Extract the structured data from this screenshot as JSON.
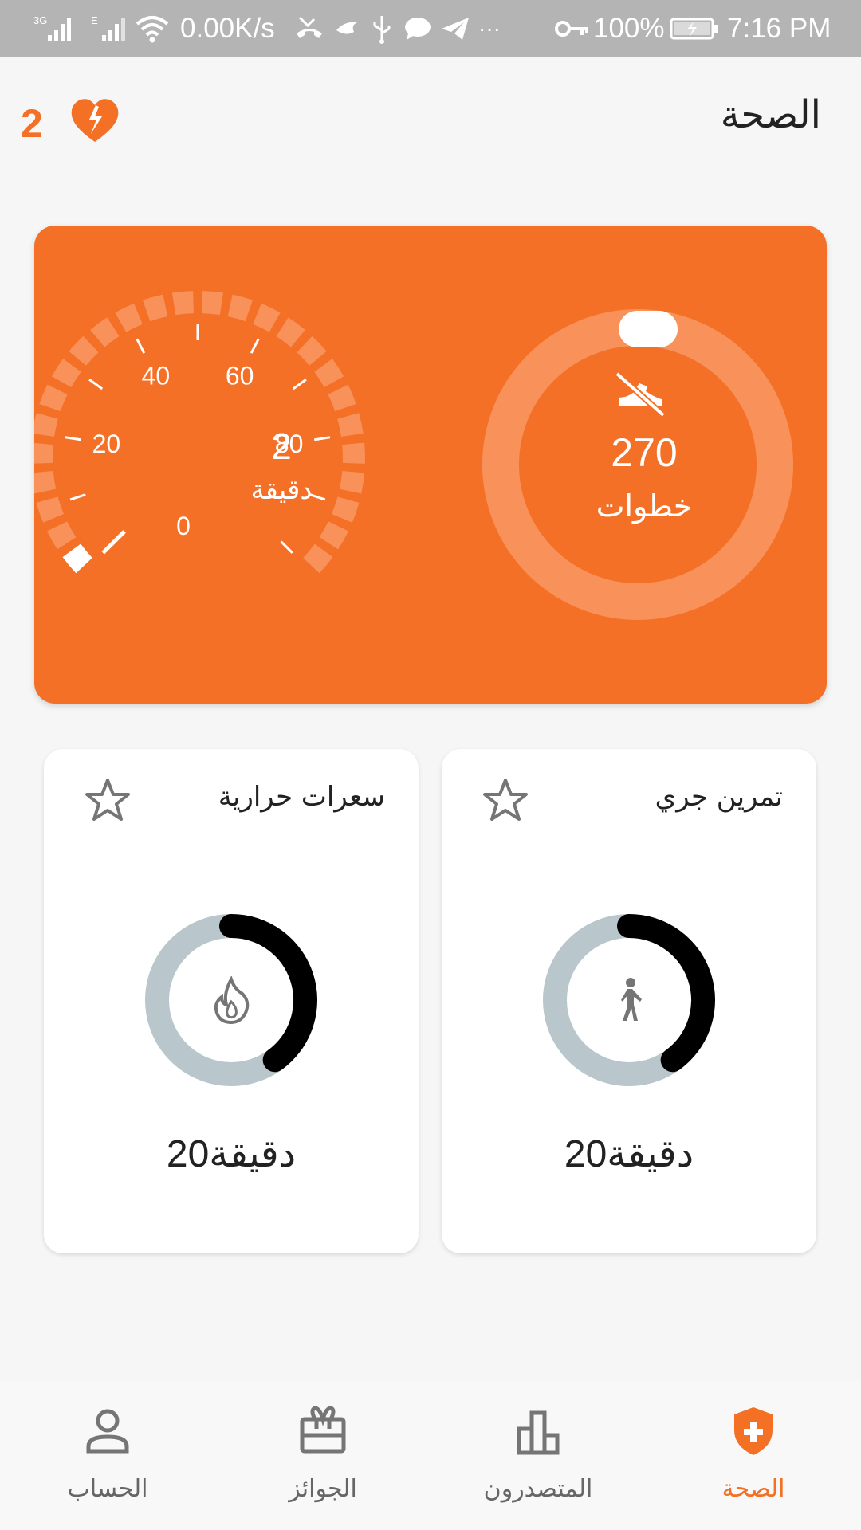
{
  "status_bar": {
    "signal1_label": "3G",
    "signal2_label": "E",
    "network_speed": "0.00K/s",
    "battery_percent": "100%",
    "time": "7:16 PM",
    "more": "···"
  },
  "header": {
    "title": "الصحة",
    "hearts_count": "2"
  },
  "hero": {
    "gauge": {
      "value": "2",
      "unit": "دقيقة",
      "ticks": [
        "0",
        "20",
        "40",
        "60",
        "80"
      ],
      "level": 0.02
    },
    "steps": {
      "value": "270",
      "unit": "خطوات"
    }
  },
  "cards": [
    {
      "title": "تمرين جري",
      "value_number": "20",
      "value_unit": "دقيقة",
      "icon": "walking-icon",
      "progress": 0.4
    },
    {
      "title": "سعرات حرارية",
      "value_number": "20",
      "value_unit": "دقيقة",
      "icon": "flame-icon",
      "progress": 0.4
    }
  ],
  "nav": {
    "items": [
      {
        "label": "الصحة",
        "icon": "shield-plus-icon",
        "active": true
      },
      {
        "label": "المتصدرون",
        "icon": "leaderboard-icon",
        "active": false
      },
      {
        "label": "الجوائز",
        "icon": "gift-icon",
        "active": false
      },
      {
        "label": "الحساب",
        "icon": "person-icon",
        "active": false
      }
    ]
  },
  "colors": {
    "accent": "#f37025",
    "card_orange": "#f47027",
    "ring_track": "#b9c7cc",
    "ring_fill": "#000000"
  }
}
